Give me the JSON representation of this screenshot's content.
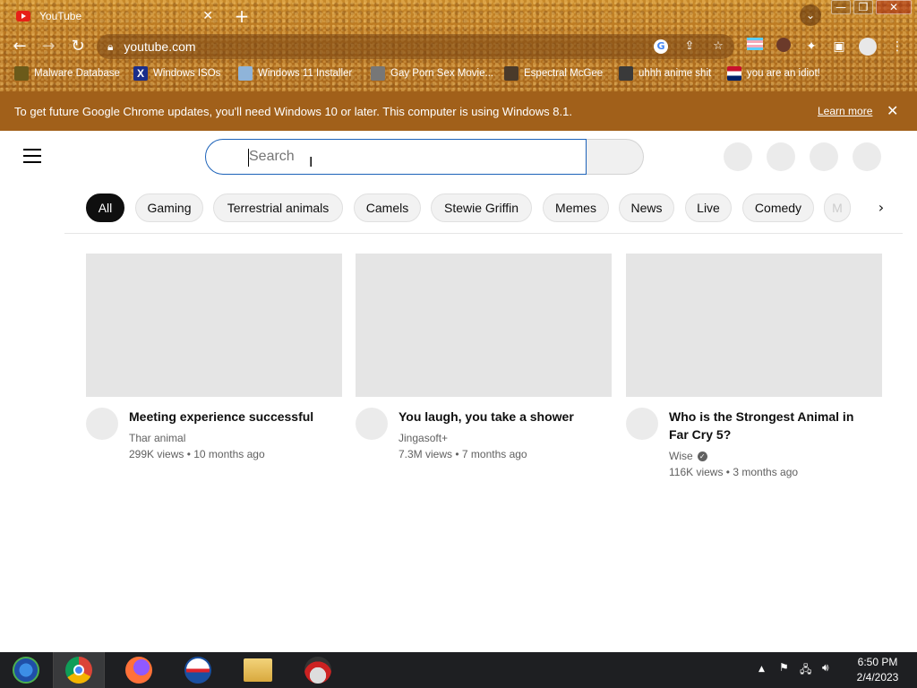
{
  "browser": {
    "tab_title": "YouTube",
    "tab_close": "✕",
    "new_tab": "+",
    "url": "youtube.com",
    "window_controls": {
      "minimize": "—",
      "maximize": "❐",
      "close": "✕"
    },
    "bookmarks": [
      {
        "label": "Malware Database",
        "icon": "malware-icon"
      },
      {
        "label": "Windows ISOs",
        "icon": "x-icon"
      },
      {
        "label": "Windows 11 Installer",
        "icon": "image-icon"
      },
      {
        "label": "Gay Porn Sex Movie...",
        "icon": "site-icon"
      },
      {
        "label": "Espectral McGee",
        "icon": "site-icon"
      },
      {
        "label": "uhhh anime shit",
        "icon": "anime-icon"
      },
      {
        "label": "you are an idiot!",
        "icon": "flag-icon"
      }
    ]
  },
  "banner": {
    "message": "To get future Google Chrome updates, you'll need Windows 10 or later. This computer is using Windows 8.1.",
    "learn_more": "Learn more",
    "close": "✕"
  },
  "youtube": {
    "search_placeholder": "Search",
    "chips": [
      "All",
      "Gaming",
      "Terrestrial animals",
      "Camels",
      "Stewie Griffin",
      "Memes",
      "News",
      "Live",
      "Comedy",
      "M"
    ],
    "next_chip": "›",
    "videos": [
      {
        "title": "Meeting experience successful",
        "channel": "Thar animal",
        "meta": "299K views • 10 months ago",
        "verified": false
      },
      {
        "title": "You laugh, you take a shower",
        "channel": "Jingasoft+",
        "meta": "7.3M views • 7 months ago",
        "verified": false
      },
      {
        "title": "Who is the Strongest Animal in Far Cry 5?",
        "channel": "Wise",
        "meta": "116K views • 3 months ago",
        "verified": true
      }
    ]
  },
  "taskbar": {
    "apps": [
      "start-button",
      "chrome-icon",
      "firefox-icon",
      "obama-icon",
      "file-explorer-icon",
      "santa-icon"
    ],
    "time": "6:50 PM",
    "date": "2/4/2023"
  },
  "colors": {
    "banner_bg": "#a1601a",
    "chip_active": "#0f0f0f",
    "search_border": "#1c62b9",
    "yt_red": "#e62117"
  }
}
